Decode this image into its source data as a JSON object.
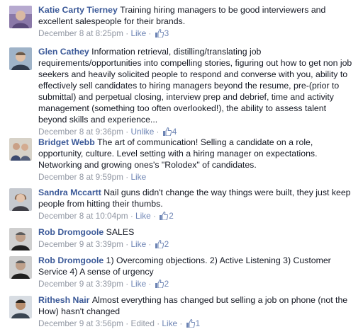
{
  "ui": {
    "separator": " · ",
    "thumb_icon": "like-thumb-icon",
    "link_color": "#3b5998",
    "meta_color": "#9197a3"
  },
  "comments": [
    {
      "author": "Katie Carty Tierney",
      "text": "Training hiring managers to be good interviewers and excellent salespeople for their brands.",
      "time": "December 8 at 8:25pm",
      "action": "Like",
      "likes": "3"
    },
    {
      "author": "Glen Cathey",
      "text": "Information retrieval, distilling/translating job requirements/opportunities into compelling stories, figuring out how to get non job seekers and heavily solicited people to respond and converse with you, ability to effectively sell candidates to hiring managers beyond the resume, pre-(prior to submittal) and perpetual closing, interview prep and debrief, time and activity management (something too often overlooked!), the ability to assess talent beyond skills and experience...",
      "time": "December 8 at 9:36pm",
      "action": "Unlike",
      "likes": "4"
    },
    {
      "author": "Bridget Webb",
      "text": "The art of communication! Selling a candidate on a role, opportunity, culture. Level setting with a hiring manager on expectations. Networking and growing ones's \"Rolodex\" of candidates.",
      "time": "December 8 at 9:59pm",
      "action": "Like",
      "likes": ""
    },
    {
      "author": "Sandra Mccartt",
      "text": "Nail guns didn't change the way things were built, they just keep people from hitting their thumbs.",
      "time": "December 8 at 10:04pm",
      "action": "Like",
      "likes": "2"
    },
    {
      "author": "Rob Dromgoole",
      "text": "SALES",
      "time": "December 9 at 3:39pm",
      "action": "Like",
      "likes": "2"
    },
    {
      "author": "Rob Dromgoole",
      "text": "1) Overcoming objections. 2) Active Listening 3) Customer Service 4) A sense of urgency",
      "time": "December 9 at 3:39pm",
      "action": "Like",
      "likes": "2"
    },
    {
      "author": "Rithesh Nair",
      "text": "Almost everything has changed but selling a job on phone (not the How) hasn't changed",
      "time": "December 9 at 3:56pm",
      "edited": "Edited",
      "action": "Like",
      "likes": "1"
    }
  ]
}
